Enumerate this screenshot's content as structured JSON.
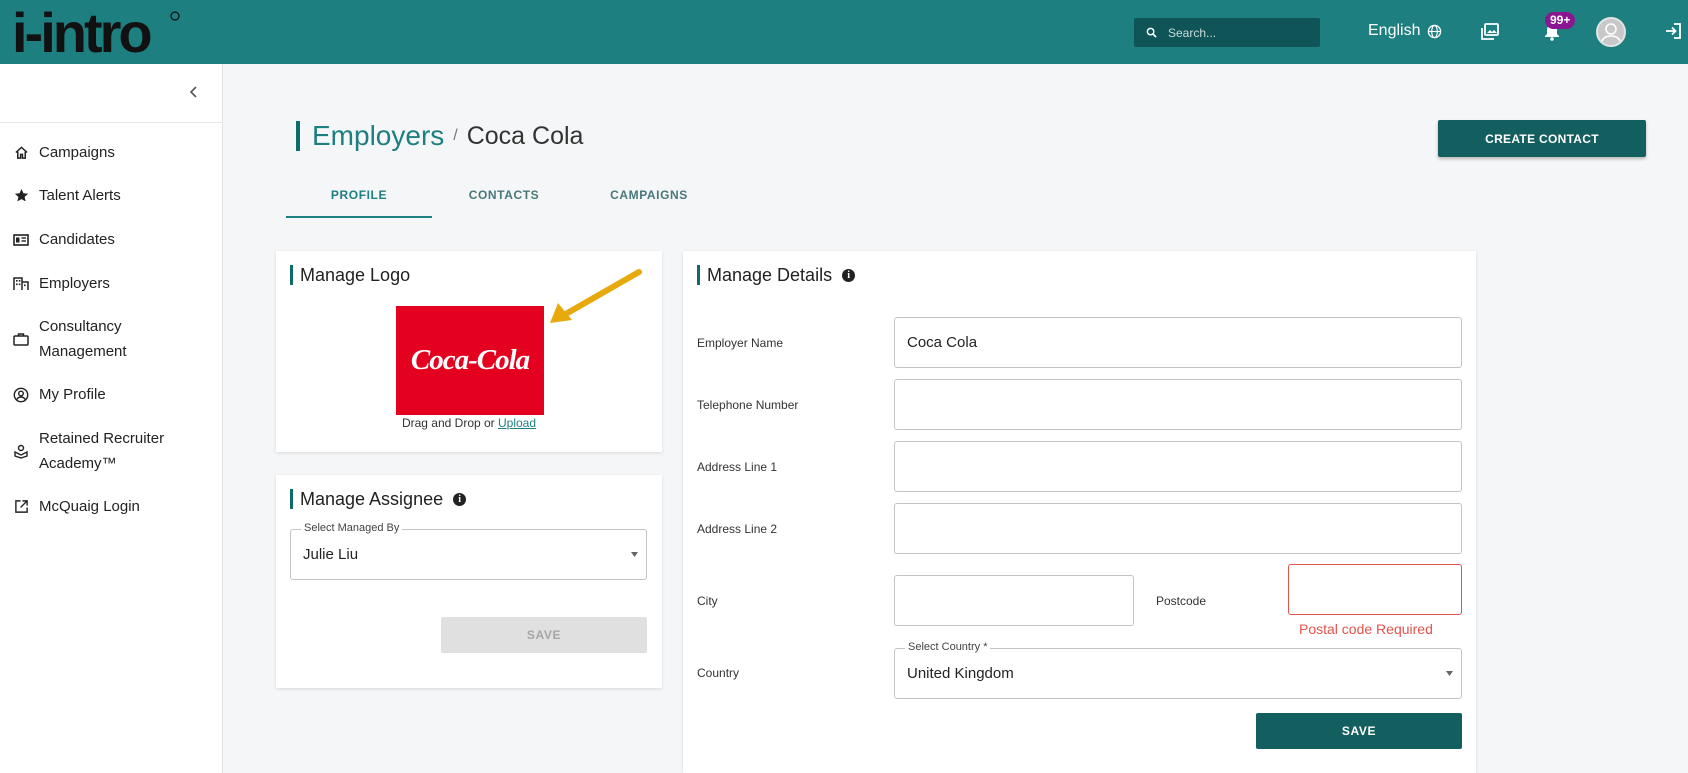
{
  "app": {
    "logo_text": "i-intro"
  },
  "header": {
    "search_placeholder": "Search...",
    "language": "English",
    "notification_count": "99+"
  },
  "sidebar": {
    "items": [
      {
        "label": "Campaigns",
        "icon": "home-icon"
      },
      {
        "label": "Talent Alerts",
        "icon": "star-icon"
      },
      {
        "label": "Candidates",
        "icon": "id-card-icon"
      },
      {
        "label": "Employers",
        "icon": "building-icon"
      },
      {
        "label": "Consultancy Management",
        "icon": "briefcase-icon"
      },
      {
        "label": "My Profile",
        "icon": "user-circle-icon"
      },
      {
        "label": "Retained Recruiter Academy™",
        "icon": "academy-icon"
      },
      {
        "label": "McQuaig Login",
        "icon": "external-link-icon"
      }
    ]
  },
  "breadcrumb": {
    "parent": "Employers",
    "separator": "/",
    "current": "Coca Cola"
  },
  "actions": {
    "create_contact": "CREATE CONTACT"
  },
  "tabs": [
    {
      "label": "PROFILE",
      "active": true
    },
    {
      "label": "CONTACTS",
      "active": false
    },
    {
      "label": "CAMPAIGNS",
      "active": false
    }
  ],
  "manage_logo": {
    "title": "Manage Logo",
    "logo_text": "Coca-Cola",
    "drag_text": "Drag and Drop or ",
    "upload_link": "Upload"
  },
  "manage_assignee": {
    "title": "Manage Assignee",
    "select_label": "Select Managed By",
    "selected": "Julie Liu",
    "save": "SAVE"
  },
  "manage_details": {
    "title": "Manage Details",
    "employer_name_label": "Employer Name",
    "employer_name_value": "Coca Cola",
    "telephone_label": "Telephone Number",
    "telephone_value": "",
    "address1_label": "Address Line 1",
    "address1_value": "",
    "address2_label": "Address Line 2",
    "address2_value": "",
    "city_label": "City",
    "city_value": "",
    "postcode_label": "Postcode",
    "postcode_value": "",
    "postcode_error": "Postal code Required",
    "country_label": "Country",
    "country_select_label": "Select Country *",
    "country_value": "United Kingdom",
    "save": "SAVE"
  },
  "colors": {
    "brand": "#1e7f80",
    "brand_dark": "#135f60",
    "error": "#e5534b",
    "badge": "#8a1791",
    "coke_red": "#e4001f"
  }
}
